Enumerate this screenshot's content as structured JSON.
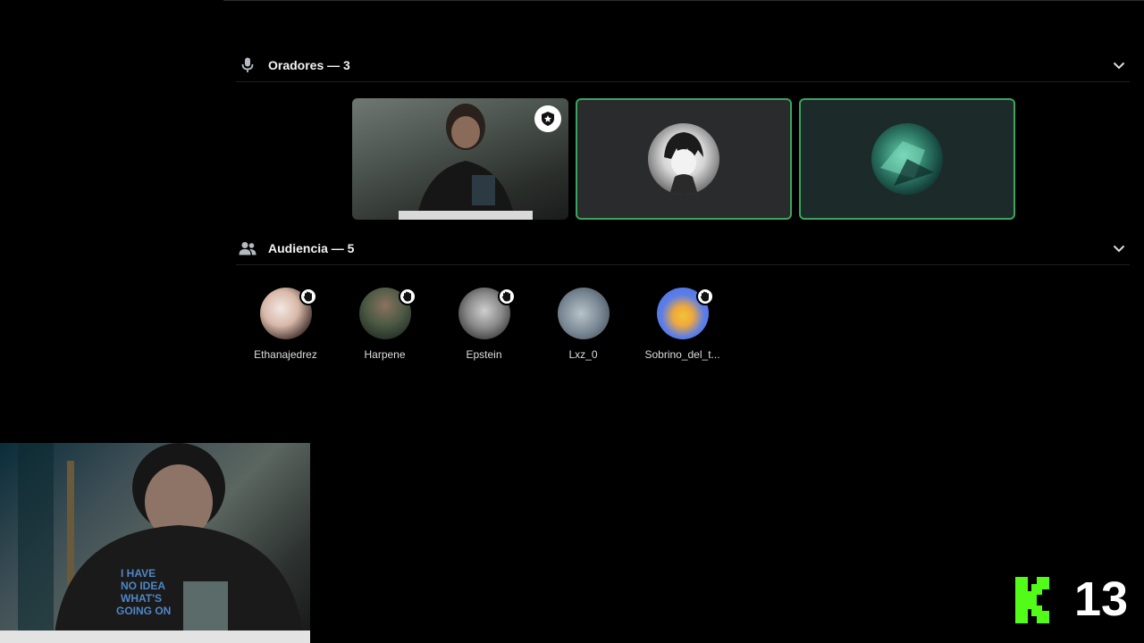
{
  "speakers": {
    "title": "Oradores — 3",
    "icon": "microphone-icon",
    "tiles": [
      {
        "type": "video",
        "moderator_badge": "moderator-badge-icon",
        "speaking": false
      },
      {
        "type": "avatar",
        "avatar": "anime-character-avatar",
        "speaking": true
      },
      {
        "type": "avatar",
        "avatar": "teal-abstract-avatar",
        "speaking": true
      }
    ]
  },
  "audience": {
    "title": "Audiencia — 5",
    "icon": "people-icon",
    "members": [
      {
        "name": "Ethanajedrez",
        "hand_raised": true
      },
      {
        "name": "Harpene",
        "hand_raised": true
      },
      {
        "name": "Epstein",
        "hand_raised": true
      },
      {
        "name": "Lxz_0",
        "hand_raised": false
      },
      {
        "name": "Sobrino_del_t...",
        "hand_raised": true
      }
    ]
  },
  "overlay": {
    "logo_letter": "K",
    "counter": "13"
  },
  "colors": {
    "background": "#000000",
    "speaking_border": "#3ba55d",
    "logo_green": "#53fc18",
    "text": "#f2f3f5"
  }
}
